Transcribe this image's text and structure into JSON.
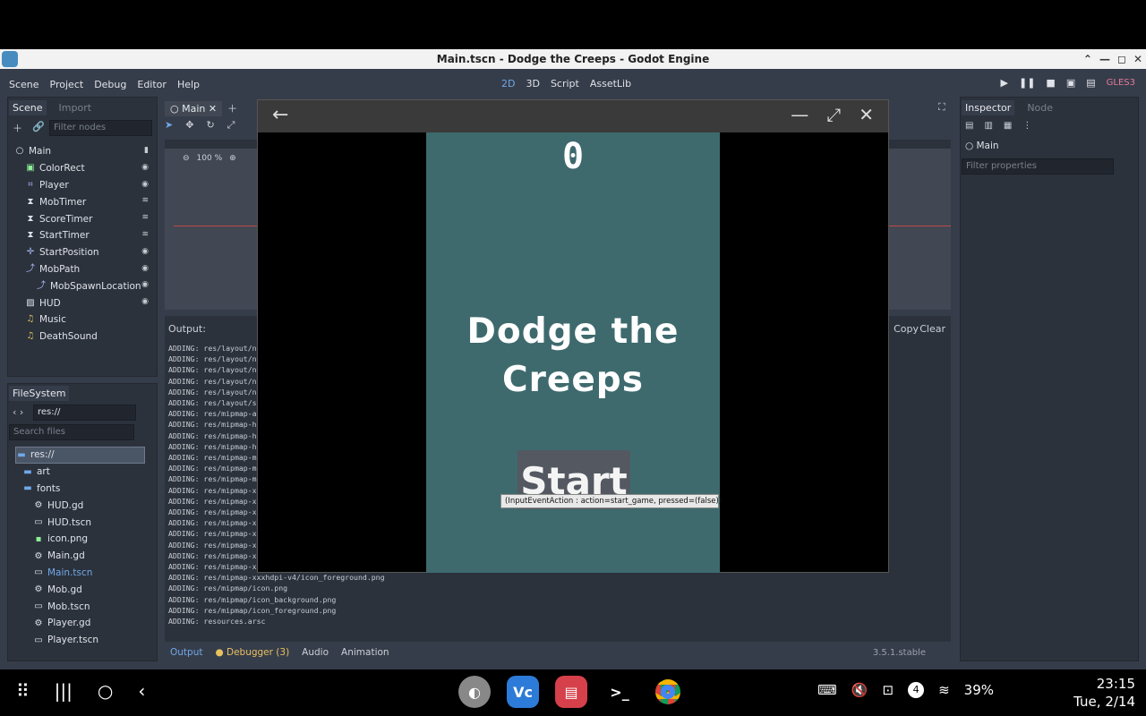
{
  "window": {
    "title": "Main.tscn - Dodge the Creeps - Godot Engine"
  },
  "menu": {
    "items": [
      "Scene",
      "Project",
      "Debug",
      "Editor",
      "Help"
    ]
  },
  "workspaces": [
    "2D",
    "3D",
    "Script",
    "AssetLib"
  ],
  "renderer": "GLES3",
  "scene_dock": {
    "tabs": [
      "Scene",
      "Import"
    ],
    "filter_placeholder": "Filter nodes",
    "nodes": [
      {
        "name": "Main",
        "icon": "node-circle",
        "indent": 0
      },
      {
        "name": "ColorRect",
        "icon": "colorrect",
        "indent": 1
      },
      {
        "name": "Player",
        "icon": "area2d",
        "indent": 1
      },
      {
        "name": "MobTimer",
        "icon": "timer",
        "indent": 1
      },
      {
        "name": "ScoreTimer",
        "icon": "timer",
        "indent": 1
      },
      {
        "name": "StartTimer",
        "icon": "timer",
        "indent": 1
      },
      {
        "name": "StartPosition",
        "icon": "position2d",
        "indent": 1
      },
      {
        "name": "MobPath",
        "icon": "path2d",
        "indent": 1
      },
      {
        "name": "MobSpawnLocation",
        "icon": "pathfollow",
        "indent": 2
      },
      {
        "name": "HUD",
        "icon": "canvaslayer",
        "indent": 1
      },
      {
        "name": "Music",
        "icon": "audio",
        "indent": 1
      },
      {
        "name": "DeathSound",
        "icon": "audio",
        "indent": 1
      }
    ]
  },
  "filesystem": {
    "title": "FileSystem",
    "path": "res://",
    "search_placeholder": "Search files",
    "items": [
      {
        "name": "res://",
        "icon": "folder",
        "selected": true
      },
      {
        "name": "art",
        "icon": "folder"
      },
      {
        "name": "fonts",
        "icon": "folder"
      },
      {
        "name": "HUD.gd",
        "icon": "gear"
      },
      {
        "name": "HUD.tscn",
        "icon": "clapper"
      },
      {
        "name": "icon.png",
        "icon": "image"
      },
      {
        "name": "Main.gd",
        "icon": "gear"
      },
      {
        "name": "Main.tscn",
        "icon": "clapper",
        "active": true
      },
      {
        "name": "Mob.gd",
        "icon": "gear"
      },
      {
        "name": "Mob.tscn",
        "icon": "clapper"
      },
      {
        "name": "Player.gd",
        "icon": "gear"
      },
      {
        "name": "Player.tscn",
        "icon": "clapper"
      }
    ]
  },
  "editor_tab": {
    "label": "Main"
  },
  "zoom": "100 %",
  "output": {
    "title": "Output:",
    "copy_label": "Copy",
    "clear_label": "Clear",
    "lines": [
      "ADDING: res/layout/nc",
      "ADDING: res/layout/nc",
      "ADDING: res/layout/nc",
      "ADDING: res/layout/nc",
      "ADDING: res/layout/nc",
      "ADDING: res/layout/st",
      "ADDING: res/mipmap-an",
      "ADDING: res/mipmap-hd",
      "ADDING: res/mipmap-hd",
      "ADDING: res/mipmap-hd",
      "ADDING: res/mipmap-md",
      "ADDING: res/mipmap-md",
      "ADDING: res/mipmap-md",
      "ADDING: res/mipmap-xh",
      "ADDING: res/mipmap-xh",
      "ADDING: res/mipmap-xh",
      "ADDING: res/mipmap-xx",
      "ADDING: res/mipmap-xx",
      "ADDING: res/mipmap-xx",
      "ADDING: res/mipmap-xx",
      "ADDING: res/mipmap-xx",
      "ADDING: res/mipmap-xxxhdpi-v4/icon_foreground.png",
      "ADDING: res/mipmap/icon.png",
      "ADDING: res/mipmap/icon_background.png",
      "ADDING: res/mipmap/icon_foreground.png",
      "ADDING: resources.arsc"
    ]
  },
  "bottom_tabs": [
    "Output",
    "Debugger (3)",
    "Audio",
    "Animation"
  ],
  "version": "3.5.1.stable",
  "inspector": {
    "tabs": [
      "Inspector",
      "Node"
    ],
    "object": "Main",
    "filter_placeholder": "Filter properties"
  },
  "game": {
    "score": "0",
    "title": "Dodge the Creeps",
    "start_label": "Start",
    "tooltip": "(InputEventAction : action=start_game, pressed=(false))"
  },
  "statusbar": {
    "notification_count": "4",
    "battery": "39%",
    "time": "23:15",
    "date": "Tue, 2/14"
  },
  "colors": {
    "accent": "#70a8e8",
    "game_bg": "#3e6a6e",
    "editor_bg": "#363d4a"
  }
}
